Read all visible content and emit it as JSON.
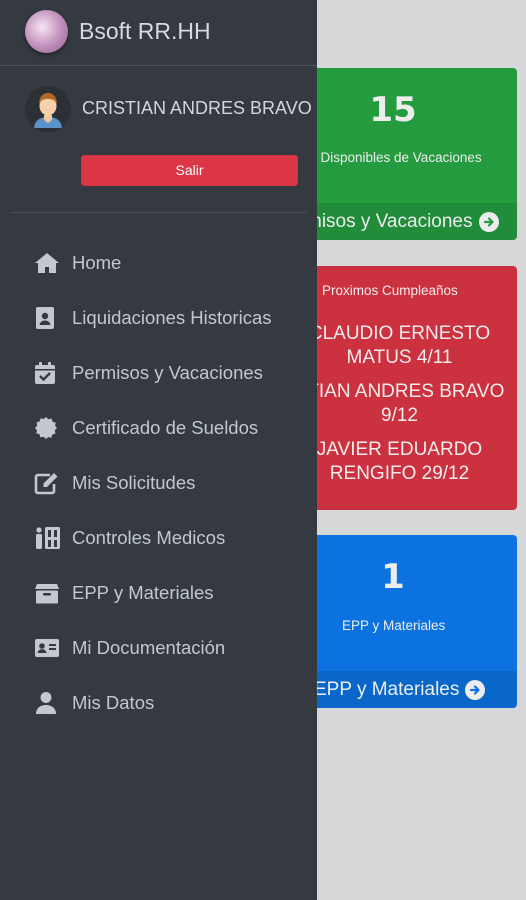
{
  "app": {
    "title": "Bsoft RR.HH"
  },
  "user": {
    "name": "CRISTIAN ANDRES BRAVO",
    "logout_label": "Salir"
  },
  "nav": {
    "items": [
      {
        "label": "Home",
        "icon": "home-icon"
      },
      {
        "label": "Liquidaciones Historicas",
        "icon": "id-badge-icon"
      },
      {
        "label": "Permisos y Vacaciones",
        "icon": "calendar-check-icon"
      },
      {
        "label": "Certificado de Sueldos",
        "icon": "certificate-icon"
      },
      {
        "label": "Mis Solicitudes",
        "icon": "edit-icon"
      },
      {
        "label": "Controles Medicos",
        "icon": "medical-icon"
      },
      {
        "label": "EPP y Materiales",
        "icon": "box-icon"
      },
      {
        "label": "Mi Documentación",
        "icon": "id-card-icon"
      },
      {
        "label": "Mis Datos",
        "icon": "user-icon"
      }
    ]
  },
  "cards": {
    "vacaciones": {
      "number": "15",
      "subtitle": "s Disponibles de Vacaciones",
      "footer": "misos y Vacaciones",
      "color": "#28a745"
    },
    "cumpleanos": {
      "title": "Proximos Cumpleaños",
      "items": [
        {
          "line1": "CLAUDIO ERNESTO",
          "line2": "MATUS 4/11"
        },
        {
          "line1": "STIAN ANDRES BRAVO",
          "line2": "9/12"
        },
        {
          "line1": "JAVIER EDUARDO",
          "line2": "RENGIFO 29/12"
        }
      ],
      "color": "#dc3545"
    },
    "epp": {
      "number": "1",
      "subtitle": "EPP y Materiales",
      "footer": "EPP y Materiales",
      "color": "#0d7bf0"
    }
  },
  "colors": {
    "drawer_bg": "#343a40",
    "nav_text": "#c2c7d0",
    "logout": "#dc3545"
  }
}
